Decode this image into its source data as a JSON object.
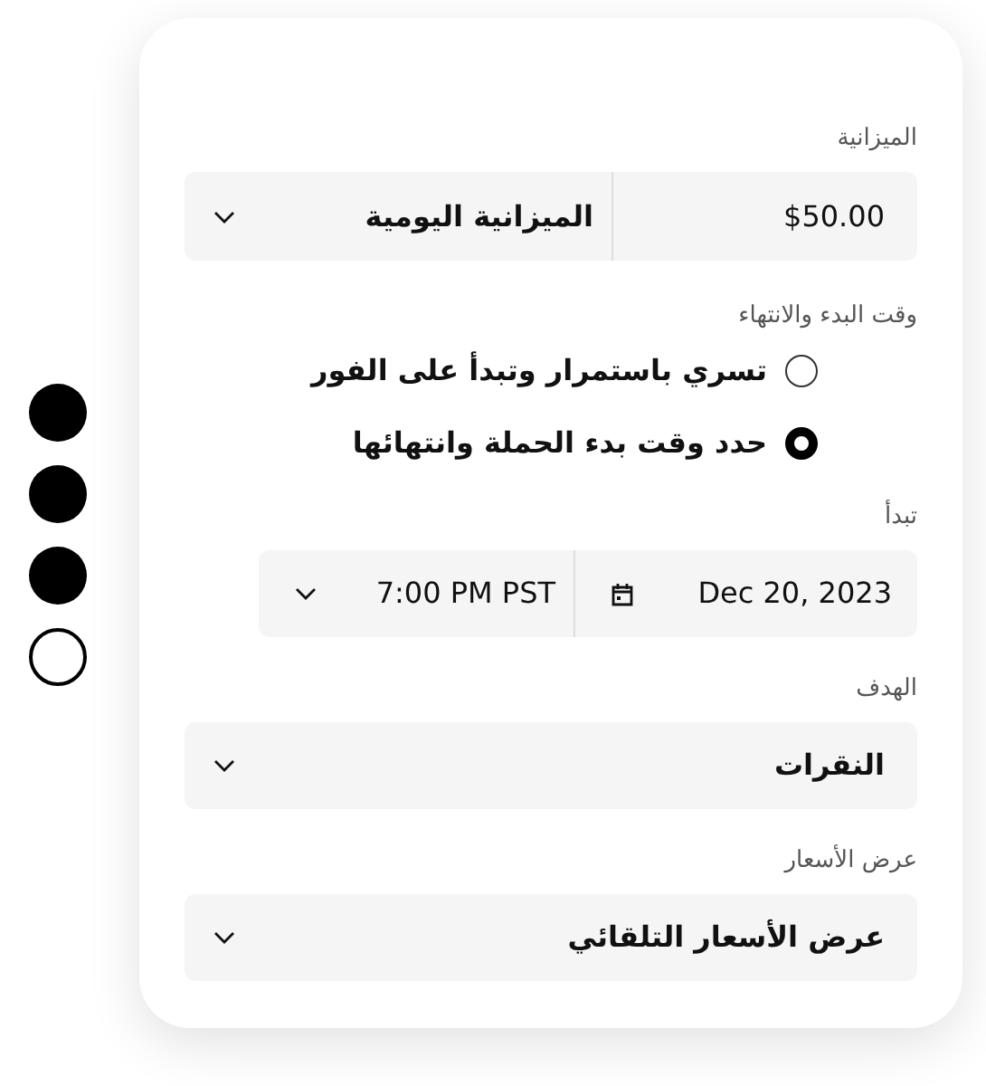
{
  "pager": {
    "dots": [
      {
        "filled": true
      },
      {
        "filled": true
      },
      {
        "filled": true
      },
      {
        "filled": false
      }
    ]
  },
  "budget": {
    "label": "الميزانية",
    "amount": "$50.00",
    "period": "الميزانية اليومية"
  },
  "schedule": {
    "label": "وقت البدء والانتهاء",
    "options": [
      {
        "label": "تسري باستمرار وتبدأ على الفور",
        "selected": false
      },
      {
        "label": "حدد وقت بدء الحملة وانتهائها",
        "selected": true
      }
    ]
  },
  "start": {
    "label": "تبدأ",
    "date": "Dec 20, 2023",
    "time": "7:00 PM PST"
  },
  "goal": {
    "label": "الهدف",
    "value": "النقرات"
  },
  "bid": {
    "label": "عرض الأسعار",
    "value": "عرض الأسعار التلقائي"
  }
}
